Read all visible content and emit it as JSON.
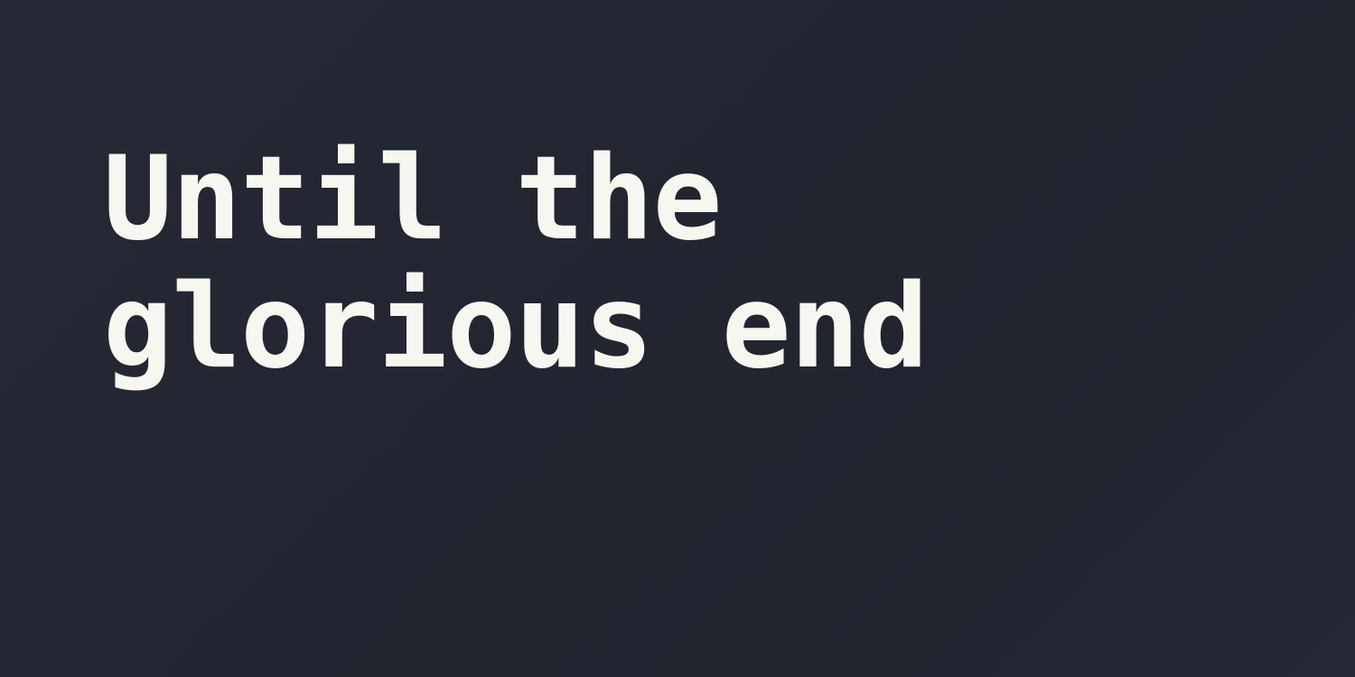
{
  "title": {
    "line1": "Until the",
    "line2": "glorious end"
  },
  "colors": {
    "background": "#23252f",
    "text": "#f6f7f0"
  }
}
